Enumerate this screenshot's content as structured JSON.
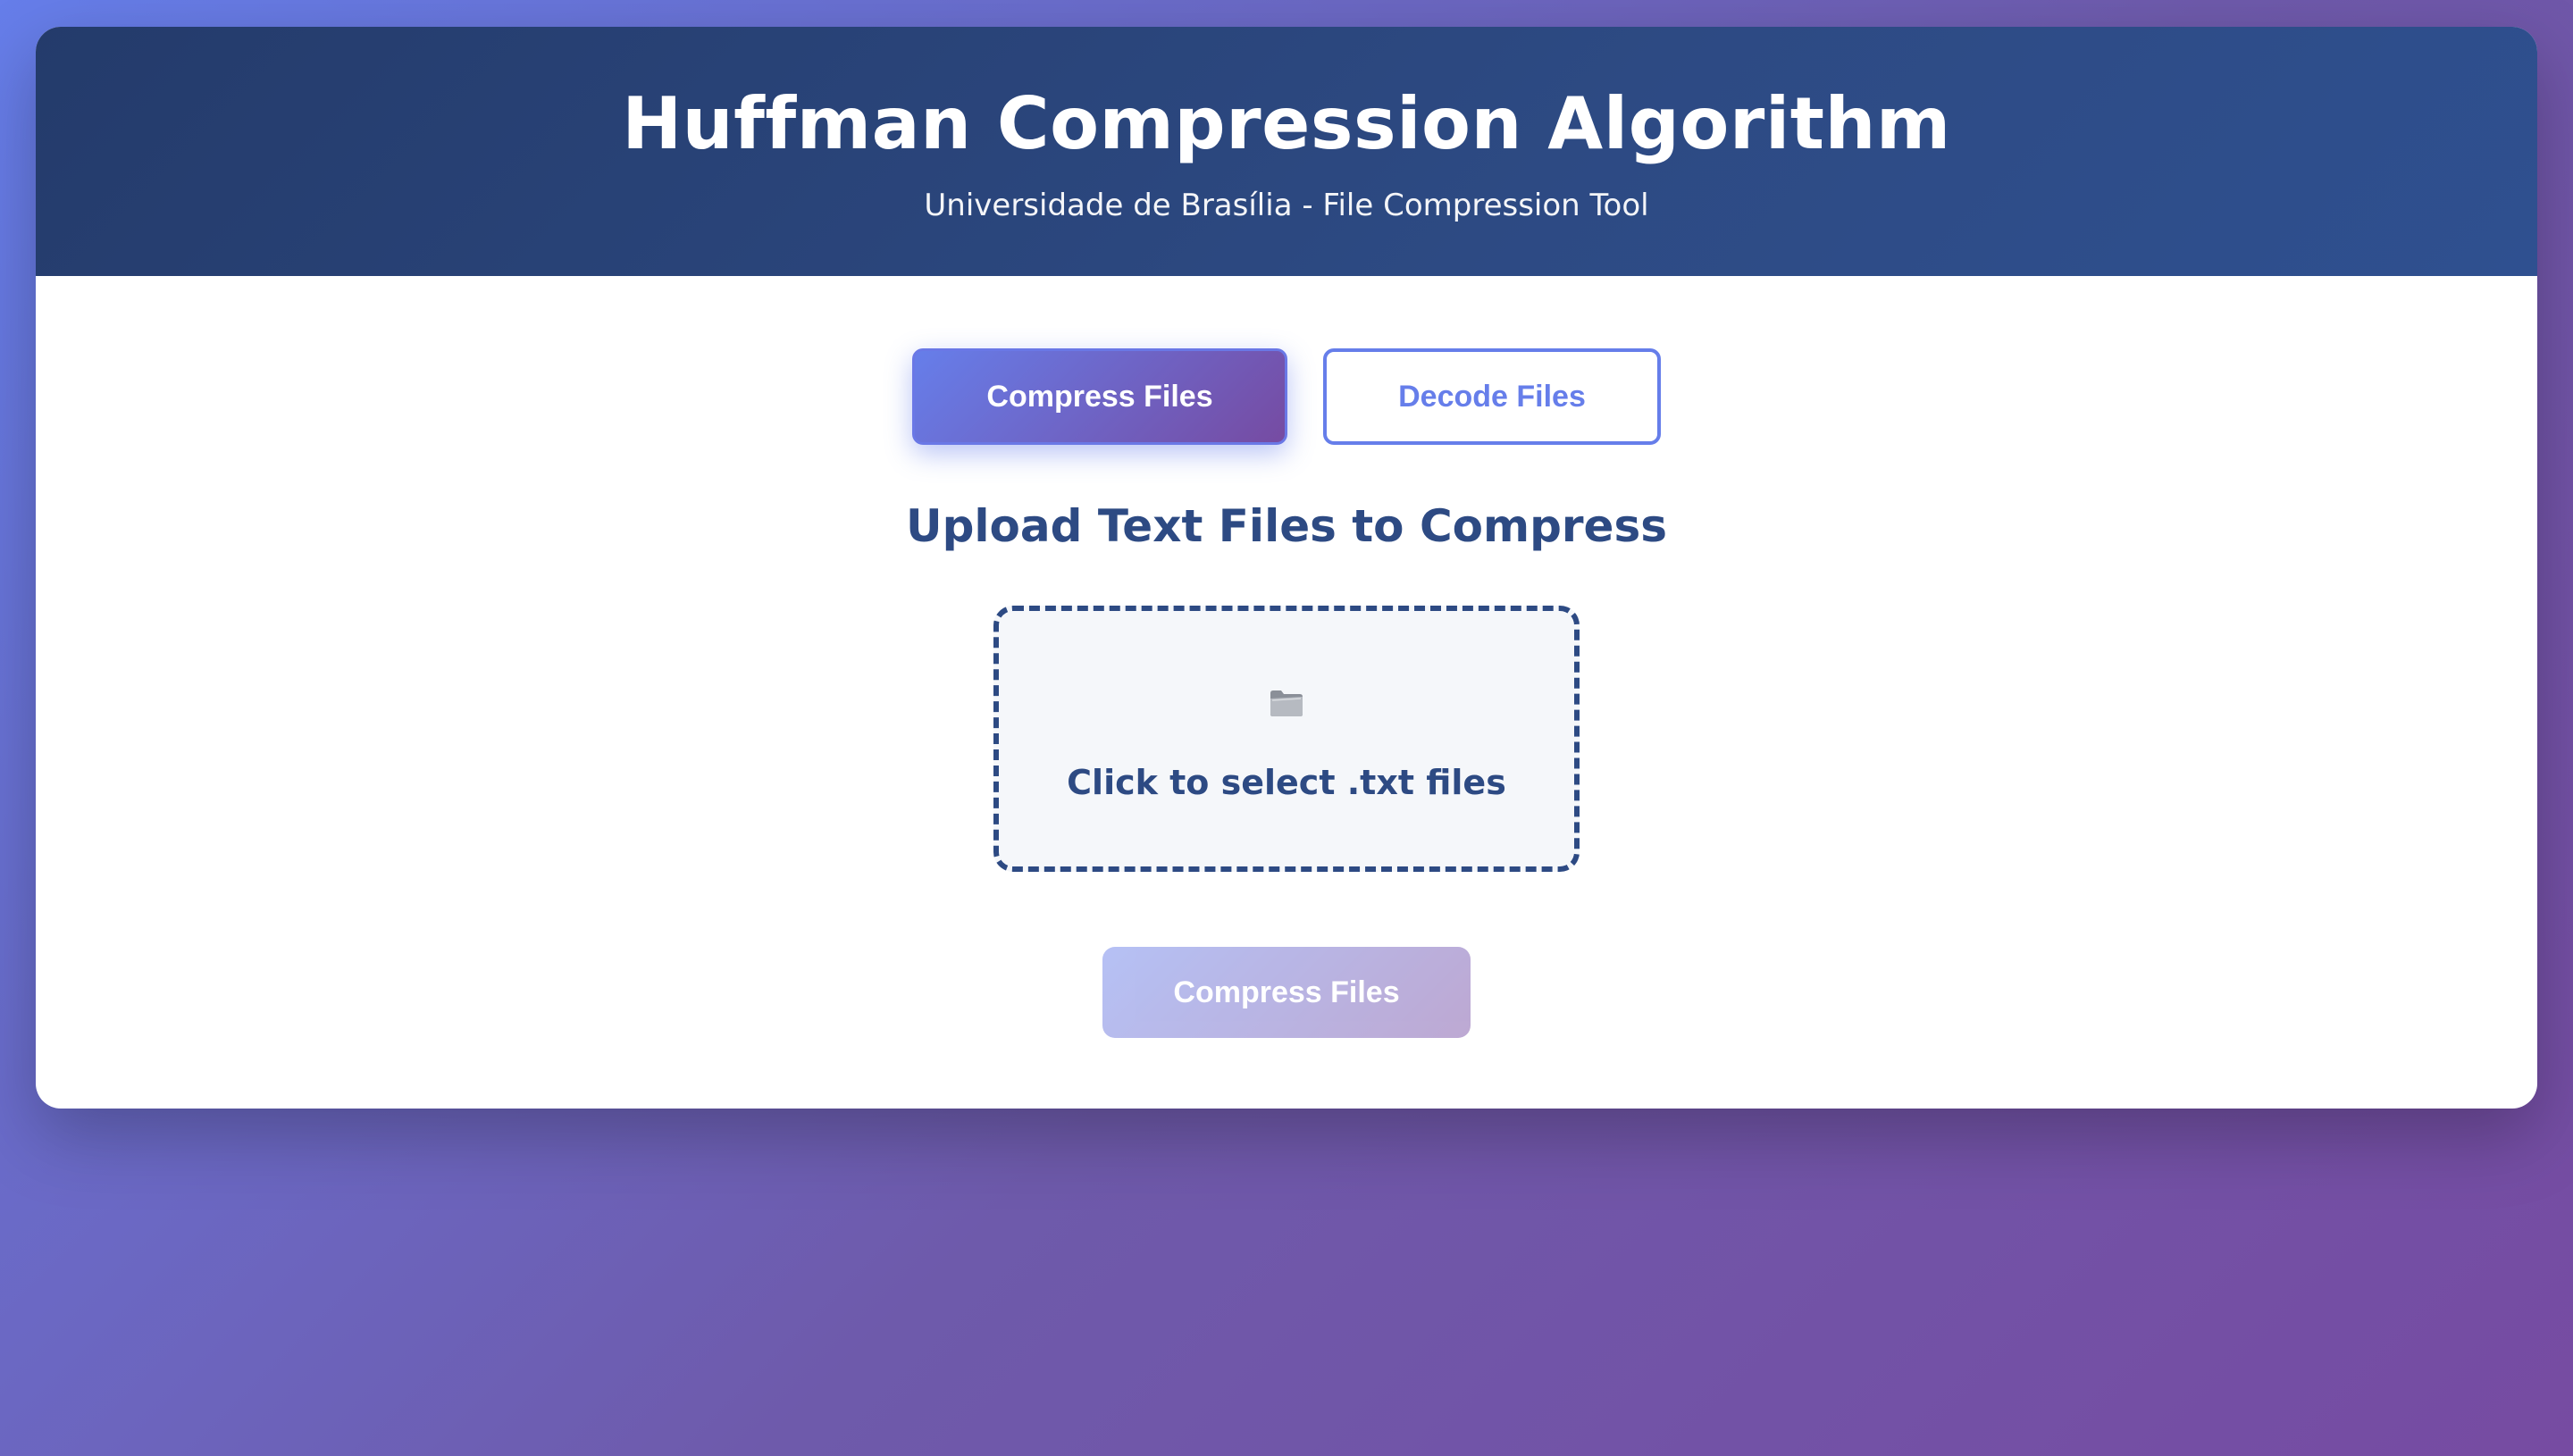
{
  "header": {
    "title": "Huffman Compression Algorithm",
    "subtitle": "Universidade de Brasília - File Compression Tool"
  },
  "tabs": [
    {
      "label": "Compress Files",
      "active": true
    },
    {
      "label": "Decode Files",
      "active": false
    }
  ],
  "compress": {
    "section_title": "Upload Text Files to Compress",
    "upload_icon": "folder-icon",
    "upload_prompt": "Click to select .txt files",
    "submit_label": "Compress Files",
    "submit_disabled": true
  },
  "colors": {
    "accent_start": "#667eea",
    "accent_end": "#764ba2",
    "header_bg": "#2d4a83",
    "text_primary": "#2d4a83"
  }
}
